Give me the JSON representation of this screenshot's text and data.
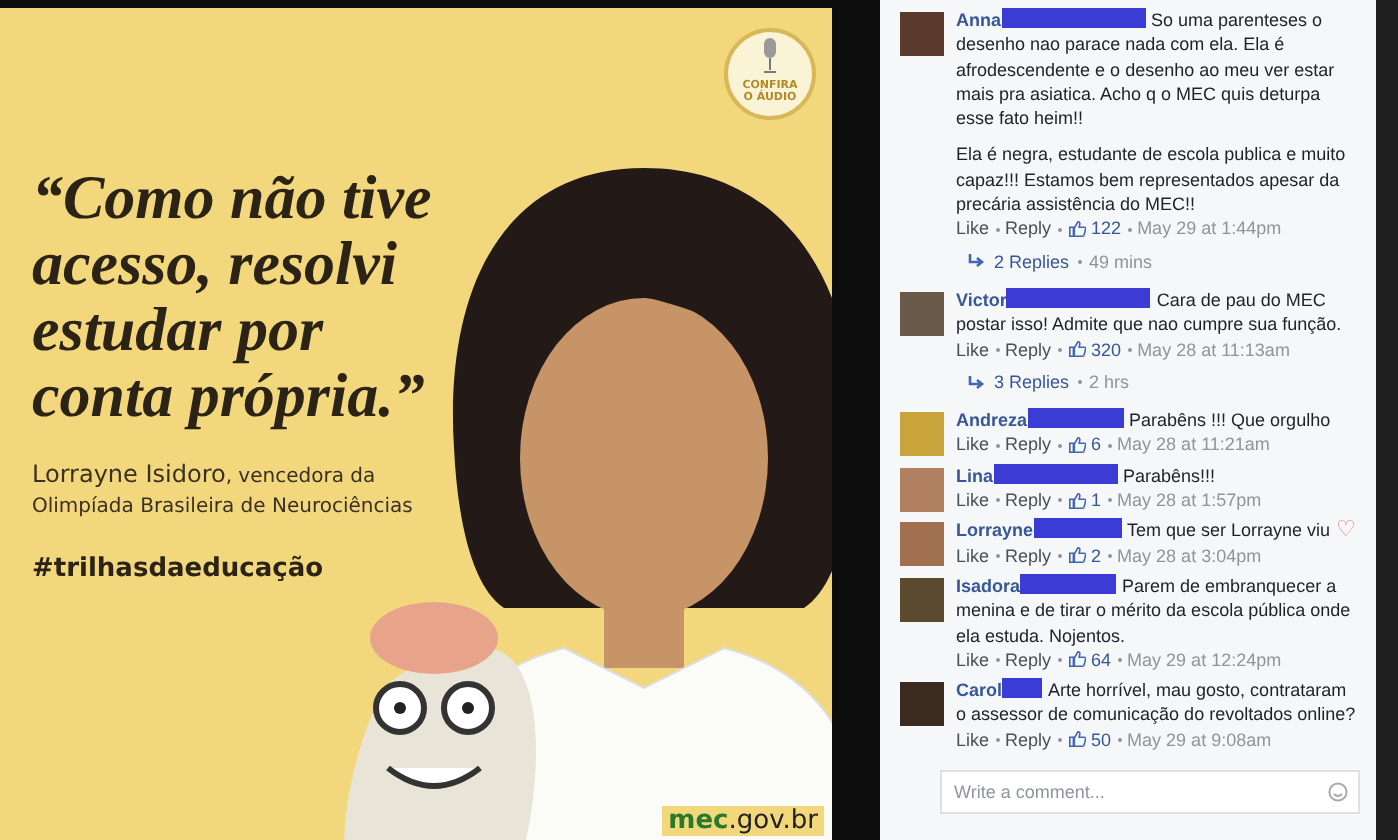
{
  "poster": {
    "badge": [
      "CONFIRA",
      "O ÁUDIO"
    ],
    "quote": [
      "“Como não tive",
      "acesso, resolvi",
      "estudar por",
      "conta própria.”"
    ],
    "credit_name": "Lorrayne Isidoro",
    "credit_rest": ", vencedora da",
    "credit_line2": "Olimpíada Brasileira de Neurociências",
    "hashtag": "#trilhasdaeducação",
    "site_bold": "mec",
    "site_rest": ".gov.br"
  },
  "comments": [
    {
      "author": "Anna",
      "paragraphs": [
        "So uma parenteses o desenho nao parace nada com ela. Ela é afrodescendente e o desenho ao meu ver estar mais pra asiatica. Acho q o MEC quis deturpa esse fato heim!!",
        "Ela é negra, estudante de escola publica e muito capaz!!! Estamos bem representados apesar da precária assistência do MEC!!"
      ],
      "like": "Like",
      "reply": "Reply",
      "likes": "122",
      "time": "May 29 at 1:44pm",
      "replies": "2 Replies",
      "replies_time": "49 mins"
    },
    {
      "author": "Victor",
      "paragraphs": [
        "Cara de pau do MEC postar isso! Admite que nao cumpre sua função."
      ],
      "like": "Like",
      "reply": "Reply",
      "likes": "320",
      "time": "May 28 at 11:13am",
      "replies": "3 Replies",
      "replies_time": "2 hrs"
    },
    {
      "author": "Andreza",
      "paragraphs": [
        "Parabêns !!! Que orgulho"
      ],
      "like": "Like",
      "reply": "Reply",
      "likes": "6",
      "time": "May 28 at 11:21am"
    },
    {
      "author": "Lina",
      "paragraphs": [
        "Parabêns!!!"
      ],
      "like": "Like",
      "reply": "Reply",
      "likes": "1",
      "time": "May 28 at 1:57pm"
    },
    {
      "author": "Lorrayne",
      "paragraphs": [
        "Tem que ser Lorrayne viu"
      ],
      "emoji": "♡",
      "like": "Like",
      "reply": "Reply",
      "likes": "2",
      "time": "May 28 at 3:04pm"
    },
    {
      "author": "Isadora",
      "paragraphs": [
        "Parem de embranquecer a menina e de tirar o mérito da escola pública onde ela estuda. Nojentos."
      ],
      "like": "Like",
      "reply": "Reply",
      "likes": "64",
      "time": "May 29 at 12:24pm"
    },
    {
      "author": "Carol",
      "paragraphs": [
        "Arte horrível, mau gosto, contrataram o assessor de comunicação do revoltados online?"
      ],
      "like": "Like",
      "reply": "Reply",
      "likes": "50",
      "time": "May 29 at 9:08am"
    }
  ],
  "comment_field": {
    "placeholder": "Write a comment..."
  }
}
